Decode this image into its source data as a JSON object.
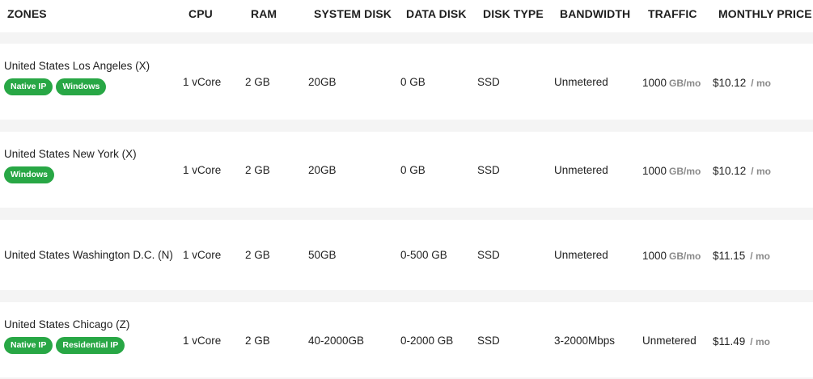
{
  "headers": {
    "zones": "ZONES",
    "cpu": "CPU",
    "ram": "RAM",
    "system_disk": "SYSTEM DISK",
    "data_disk": "DATA DISK",
    "disk_type": "DISK TYPE",
    "bandwidth": "BANDWIDTH",
    "traffic": "TRAFFIC",
    "monthly_price": "MONTHLY PRICE"
  },
  "rows": [
    {
      "zone": "United States Los Angeles (X)",
      "tags": [
        "Native IP",
        "Windows"
      ],
      "cpu": "1 vCore",
      "ram": "2 GB",
      "system_disk": "20GB",
      "data_disk": "0 GB",
      "disk_type": "SSD",
      "bandwidth": "Unmetered",
      "traffic_value": "1000",
      "traffic_unit": "GB/mo",
      "price": "$10.12",
      "price_unit": "/ mo"
    },
    {
      "zone": "United States New York (X)",
      "tags": [
        "Windows"
      ],
      "cpu": "1 vCore",
      "ram": "2 GB",
      "system_disk": "20GB",
      "data_disk": "0 GB",
      "disk_type": "SSD",
      "bandwidth": "Unmetered",
      "traffic_value": "1000",
      "traffic_unit": "GB/mo",
      "price": "$10.12",
      "price_unit": "/ mo"
    },
    {
      "zone": "United States Washington D.C. (N)",
      "tags": [],
      "cpu": "1 vCore",
      "ram": "2 GB",
      "system_disk": "50GB",
      "data_disk": "0-500 GB",
      "disk_type": "SSD",
      "bandwidth": "Unmetered",
      "traffic_value": "1000",
      "traffic_unit": "GB/mo",
      "price": "$11.15",
      "price_unit": "/ mo"
    },
    {
      "zone": "United States Chicago (Z)",
      "tags": [
        "Native IP",
        "Residential IP"
      ],
      "cpu": "1 vCore",
      "ram": "2 GB",
      "system_disk": "40-2000GB",
      "data_disk": "0-2000 GB",
      "disk_type": "SSD",
      "bandwidth": "3-2000Mbps",
      "traffic_value": "Unmetered",
      "traffic_unit": "",
      "price": "$11.49",
      "price_unit": "/ mo"
    }
  ],
  "colors": {
    "tag_background": "#28a745",
    "page_background": "#f4f4f4"
  }
}
